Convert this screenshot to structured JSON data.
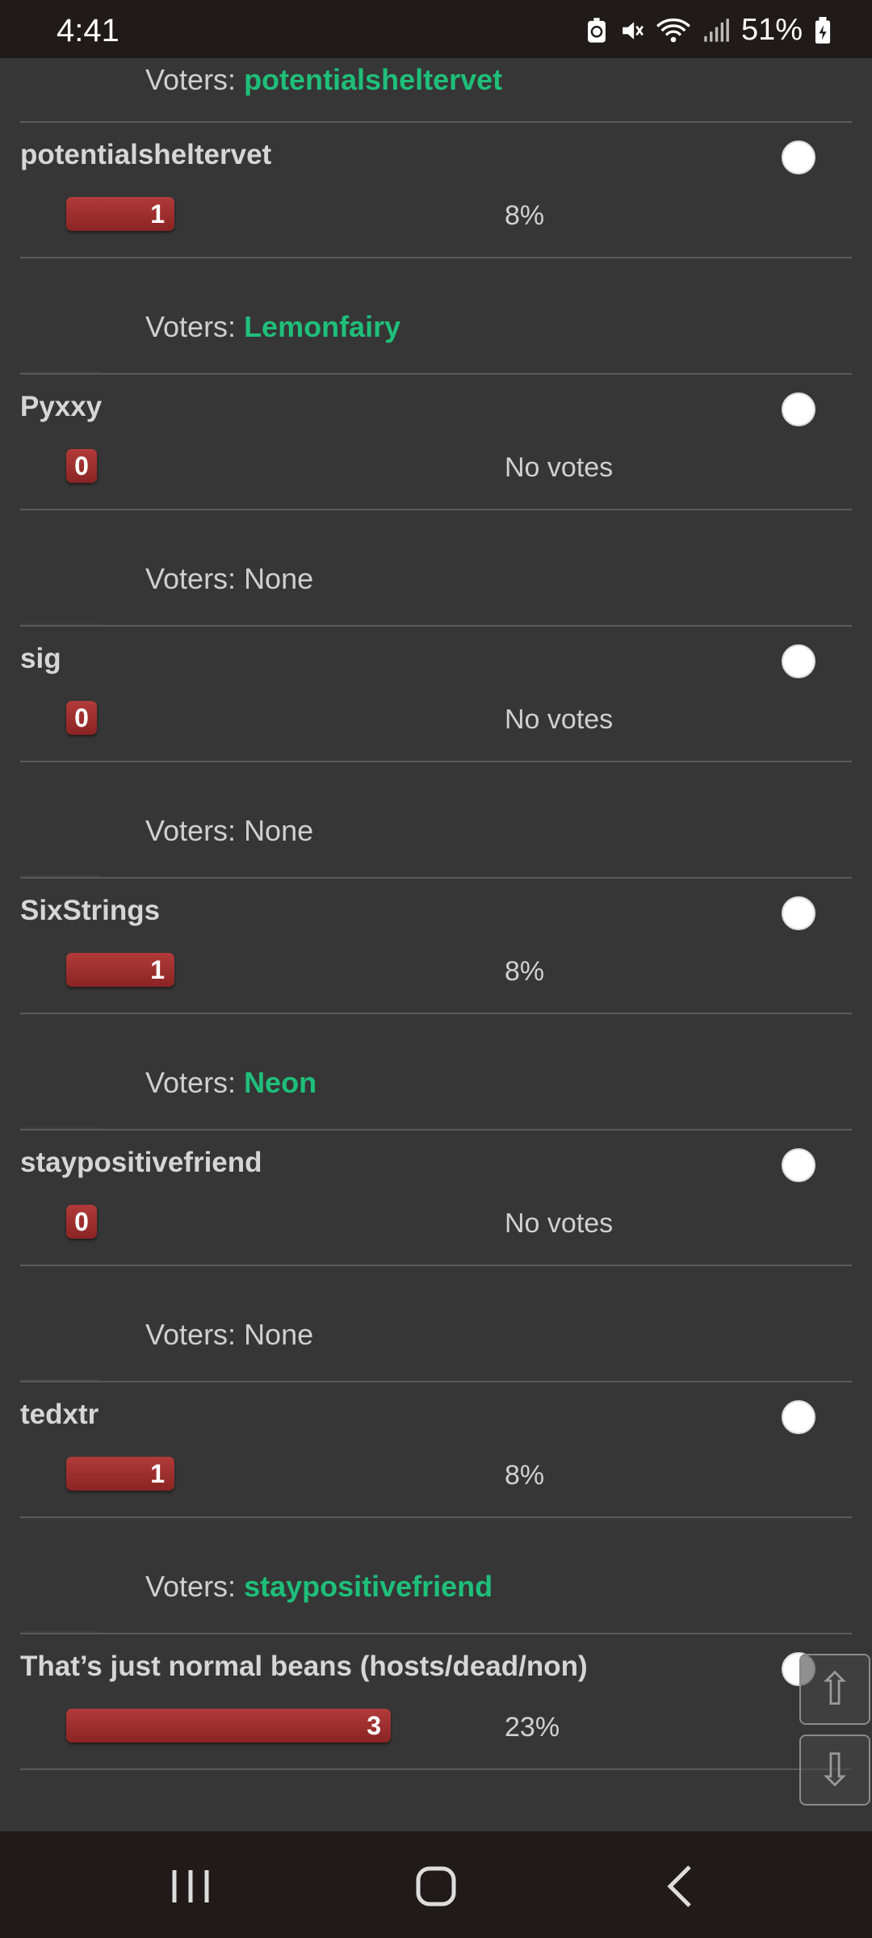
{
  "status_bar": {
    "time": "4:41",
    "battery_percent": "51%",
    "icons": [
      "battery-saver-icon",
      "mute-icon",
      "wifi-icon",
      "signal-icon",
      "battery-icon"
    ]
  },
  "poll": {
    "first_voters": {
      "prefix": "Voters: ",
      "names": "potentialsheltervet"
    },
    "options": [
      {
        "title": "potentialsheltervet",
        "count": "1",
        "percent": "8%",
        "fill": 0.333,
        "voters_prefix": "Voters: ",
        "voters": "Lemonfairy",
        "voters_highlight": true
      },
      {
        "title": "Pyxxy",
        "count": "0",
        "percent": "No votes",
        "fill": 0,
        "voters_prefix": "Voters: ",
        "voters": "None",
        "voters_highlight": false
      },
      {
        "title": "sig",
        "count": "0",
        "percent": "No votes",
        "fill": 0,
        "voters_prefix": "Voters: ",
        "voters": "None",
        "voters_highlight": false
      },
      {
        "title": "SixStrings",
        "count": "1",
        "percent": "8%",
        "fill": 0.333,
        "voters_prefix": "Voters: ",
        "voters": "Neon",
        "voters_highlight": true
      },
      {
        "title": "staypositivefriend",
        "count": "0",
        "percent": "No votes",
        "fill": 0,
        "voters_prefix": "Voters: ",
        "voters": "None",
        "voters_highlight": false
      },
      {
        "title": "tedxtr",
        "count": "1",
        "percent": "8%",
        "fill": 0.333,
        "voters_prefix": "Voters: ",
        "voters": "staypositivefriend",
        "voters_highlight": true
      },
      {
        "title": "That’s just normal beans (hosts/dead/non)",
        "count": "3",
        "percent": "23%",
        "fill": 1.0,
        "voters_prefix": "",
        "voters": "",
        "voters_highlight": false
      }
    ]
  },
  "scroll_buttons": {
    "up": "⇧",
    "down": "⇩"
  },
  "colors": {
    "background": "#363636",
    "accent_green": "#1fbf7a",
    "bar_red": "#a03030"
  }
}
